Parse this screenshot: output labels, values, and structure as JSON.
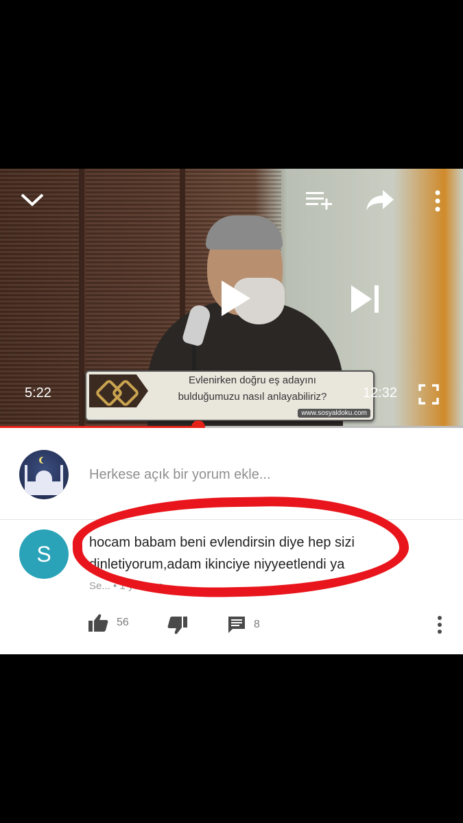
{
  "video": {
    "current_time": "5:22",
    "duration": "12:32",
    "progress_fraction": 0.428,
    "banner_line1": "Evlenirken doğru eş adayını",
    "banner_line2": "bulduğumuzu nasıl anlayabiliriz?",
    "banner_site": "www.sosyaldoku.com",
    "icons": [
      "chevron-down-icon",
      "add-to-queue-icon",
      "share-icon",
      "more-vertical-icon",
      "play-icon",
      "skip-next-icon",
      "fullscreen-icon"
    ]
  },
  "comment_box": {
    "placeholder": "Herkese açık bir yorum ekle..."
  },
  "comment": {
    "avatar_letter": "S",
    "text": "hocam babam beni evlendirsin diye hep sizi dinletiyorum,adam ikinciye niyyeetlendi ya",
    "meta": "Se... • 1 yıl önce",
    "likes": "56",
    "replies": "8"
  },
  "colors": {
    "accent_red": "#e62117",
    "highlight_red": "#e8161c",
    "avatar_teal": "#2aa3b8"
  }
}
